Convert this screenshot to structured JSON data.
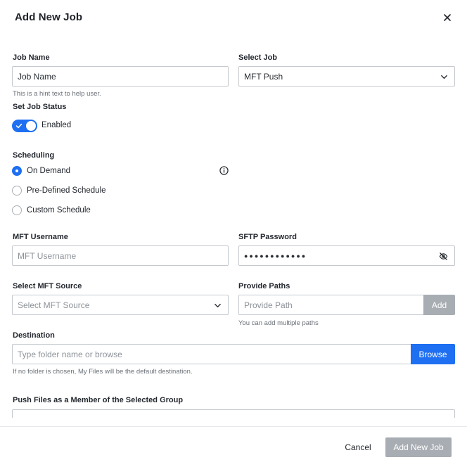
{
  "dialog": {
    "title": "Add New Job"
  },
  "job_name": {
    "label": "Job Name",
    "value": "Job Name",
    "hint": "This is a hint text to help user."
  },
  "select_job": {
    "label": "Select Job",
    "value": "MFT Push"
  },
  "job_status": {
    "label": "Set Job Status",
    "toggle_label": "Enabled",
    "enabled": true
  },
  "scheduling": {
    "label": "Scheduling",
    "options": [
      {
        "label": "On Demand",
        "selected": true
      },
      {
        "label": "Pre-Defined Schedule",
        "selected": false
      },
      {
        "label": "Custom Schedule",
        "selected": false
      }
    ]
  },
  "mft_username": {
    "label": "MFT Username",
    "placeholder": "MFT Username"
  },
  "sftp_password": {
    "label": "SFTP Password",
    "masked_value": "●●●●●●●●●●●●"
  },
  "mft_source": {
    "label": "Select MFT Source",
    "placeholder": "Select MFT Source"
  },
  "paths": {
    "label": "Provide Paths",
    "placeholder": "Provide Path",
    "add_label": "Add",
    "hint": "You can add multiple paths"
  },
  "destination": {
    "label": "Destination",
    "placeholder": "Type folder name or browse",
    "browse_label": "Browse",
    "hint": "If no folder is chosen, My Files will be the default destination."
  },
  "group": {
    "label": "Push Files as a Member of the Selected Group"
  },
  "footer": {
    "cancel_label": "Cancel",
    "submit_label": "Add New Job"
  },
  "colors": {
    "accent": "#1e6ff1",
    "disabled": "#a8adb3"
  }
}
